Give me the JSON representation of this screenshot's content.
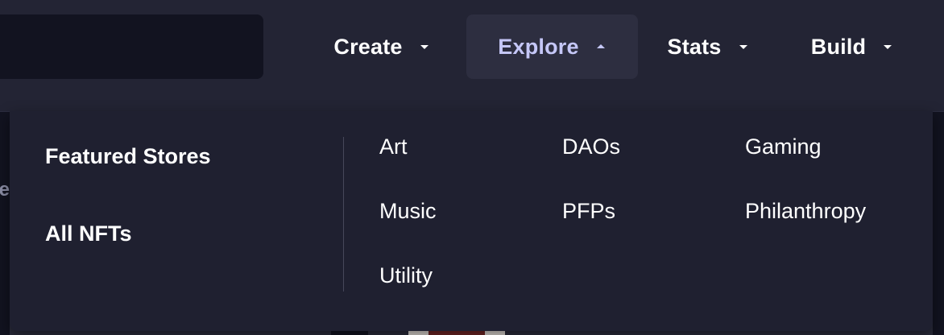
{
  "nav": {
    "items": [
      {
        "label": "Create",
        "expanded": false
      },
      {
        "label": "Explore",
        "expanded": true
      },
      {
        "label": "Stats",
        "expanded": false
      },
      {
        "label": "Build",
        "expanded": false
      }
    ],
    "active_color": "#c5c7f7"
  },
  "background": {
    "partial_text": "le"
  },
  "dropdown": {
    "primary_links": [
      "Featured Stores",
      "All NFTs"
    ],
    "categories": [
      "Art",
      "DAOs",
      "Gaming",
      "Music",
      "PFPs",
      "Philanthropy",
      "Utility"
    ]
  },
  "icons": {
    "collapsed": "chevron-down-icon",
    "expanded": "chevron-up-icon"
  }
}
